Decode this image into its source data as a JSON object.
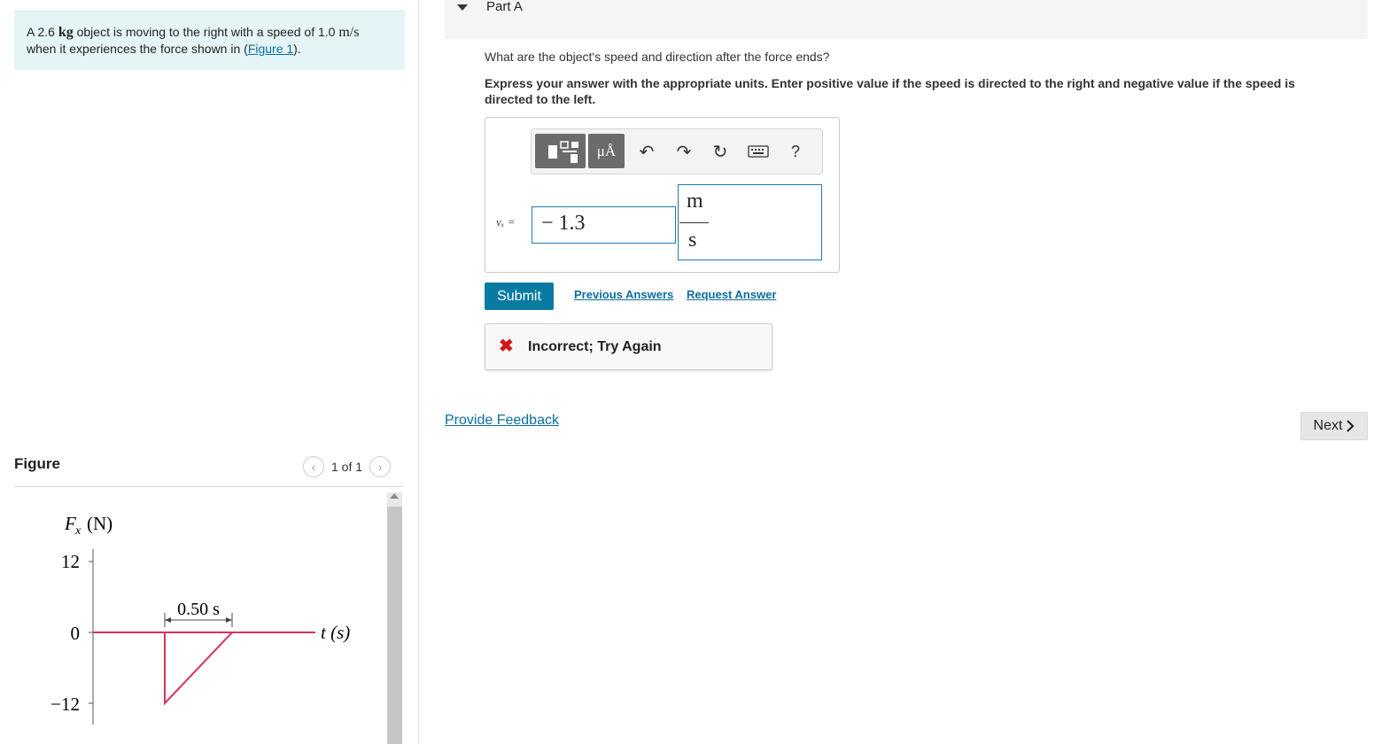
{
  "problem": {
    "text_before_mass": "A 2.6 ",
    "mass_unit": "kg",
    "text_after_mass": " object is moving to the right with a speed of 1.0 ",
    "speed_unit": "m/s",
    "line2_text": "when it experiences the force shown in (",
    "figure_link": "Figure 1",
    "line2_end": ")."
  },
  "figure": {
    "label": "Figure",
    "pager_text": "1 of 1",
    "prev_icon": "chevron-left-icon",
    "next_icon": "chevron-right-icon"
  },
  "chart_data": {
    "type": "line",
    "ylabel_var": "F",
    "ylabel_sub": "x",
    "ylabel_unit": "(N)",
    "xlabel": "t (s)",
    "yticks": [
      "12",
      "0",
      "−12"
    ],
    "duration_label": "0.50 s",
    "ylim": [
      -12,
      12
    ],
    "points": [
      {
        "t": 0.0,
        "F": 0
      },
      {
        "t": 0.0,
        "F": -12
      },
      {
        "t": 0.5,
        "F": 0
      }
    ],
    "color": "#d0365f"
  },
  "part": {
    "title": "Part A",
    "question": "What are the object's speed and direction after the force ends?",
    "instructions": "Express your answer with the appropriate units. Enter positive value if the speed is directed to the right and negative value if the speed is directed to the left."
  },
  "toolbar": {
    "templates_icon": "templates-icon",
    "units_label": "μÅ",
    "undo_glyph": "↶",
    "redo_glyph": "↷",
    "reset_glyph": "↻",
    "keyboard_icon": "keyboard-icon",
    "help_label": "?"
  },
  "answer": {
    "var_label": "vₓ =",
    "value": "− 1.3",
    "unit_numerator": "m",
    "unit_denominator": "s"
  },
  "actions": {
    "submit": "Submit",
    "previous_answers": "Previous Answers",
    "request_answer": "Request Answer"
  },
  "feedback": {
    "icon": "x-icon",
    "text": "Incorrect; Try Again"
  },
  "footer": {
    "provide_feedback": "Provide Feedback",
    "next": "Next"
  },
  "colors": {
    "accent": "#0b7aa3",
    "link": "#0a6e9e",
    "error": "#d0171c",
    "problem_bg": "#e5f5f7"
  }
}
